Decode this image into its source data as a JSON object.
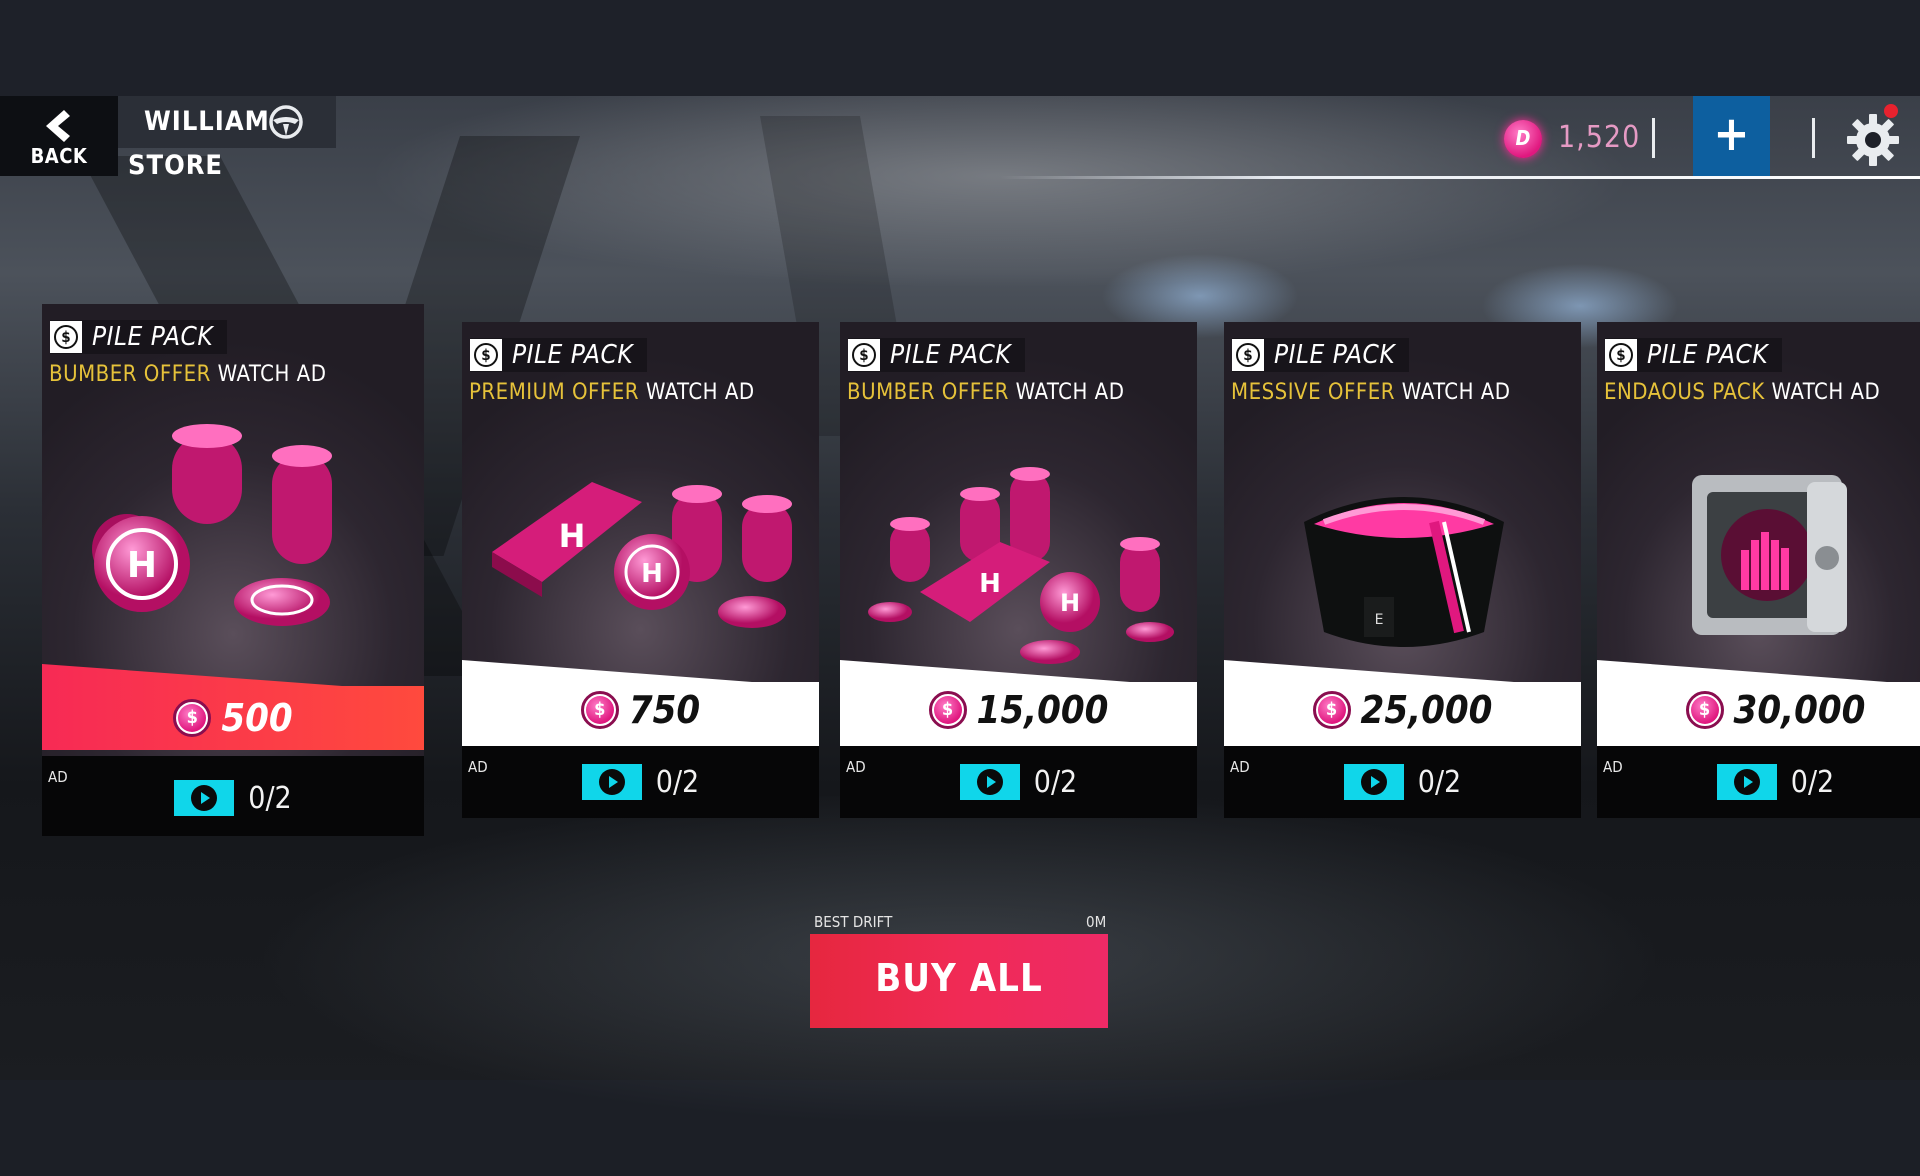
{
  "header": {
    "back_label": "BACK",
    "player_name": "WILLIAM",
    "screen_title": "STORE",
    "currency_value": "1,520",
    "currency_icon_glyph": "D"
  },
  "cards": [
    {
      "title": "PILE PACK",
      "offer": "BUMBER OFFER",
      "action": "WATCH AD",
      "price": "500",
      "ad_label": "AD",
      "progress": "0/2",
      "highlighted": true
    },
    {
      "title": "PILE PACK",
      "offer": "PREMIUM OFFER",
      "action": "WATCH AD",
      "price": "750",
      "ad_label": "AD",
      "progress": "0/2",
      "highlighted": false
    },
    {
      "title": "PILE PACK",
      "offer": "BUMBER OFFER",
      "action": "WATCH AD",
      "price": "15,000",
      "ad_label": "AD",
      "progress": "0/2",
      "highlighted": false
    },
    {
      "title": "PILE PACK",
      "offer": "MESSIVE OFFER",
      "action": "WATCH AD",
      "price": "25,000",
      "ad_label": "AD",
      "progress": "0/2",
      "highlighted": false
    },
    {
      "title": "PILE PACK",
      "offer": "ENDAOUS PACK",
      "action": "WATCH AD",
      "price": "30,000",
      "ad_label": "AD",
      "progress": "0/2",
      "highlighted": false
    }
  ],
  "footer": {
    "buy_all_label": "BUY ALL",
    "caption_left": "BEST DRIFT",
    "caption_right": "0M"
  },
  "colors": {
    "accent_pink": "#e0187f",
    "plus_button_blue": "#0d5f9f",
    "watch_button_cyan": "#10d6ea",
    "offer_gold": "#e6c23a",
    "buy_all_red": "#ee2a55"
  },
  "icons": [
    "back-chevron-icon",
    "steering-wheel-icon",
    "currency-coin-icon",
    "plus-icon",
    "gear-icon",
    "dollar-coin-icon",
    "play-video-icon"
  ]
}
